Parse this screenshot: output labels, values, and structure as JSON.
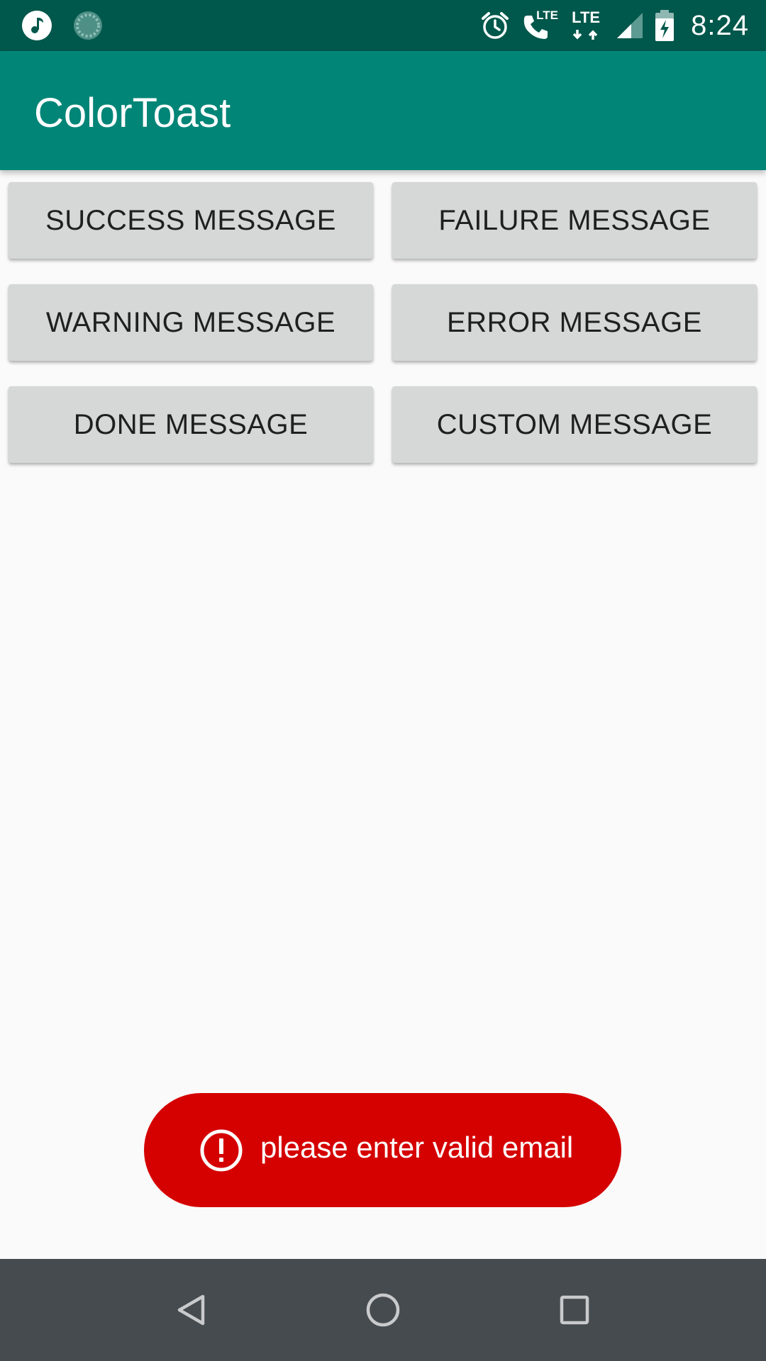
{
  "status_bar": {
    "time": "8:24",
    "left_icons": [
      "music-icon",
      "sync-icon"
    ],
    "right_icons": [
      "alarm-icon",
      "volte-call-icon",
      "lte-data-icon",
      "signal-icon",
      "battery-charging-icon"
    ],
    "volte_label": "LTE",
    "lte_label": "LTE"
  },
  "app_bar": {
    "title": "ColorToast"
  },
  "buttons": [
    {
      "label": "SUCCESS MESSAGE"
    },
    {
      "label": "FAILURE MESSAGE"
    },
    {
      "label": "WARNING MESSAGE"
    },
    {
      "label": "ERROR MESSAGE"
    },
    {
      "label": "DONE MESSAGE"
    },
    {
      "label": "CUSTOM MESSAGE"
    }
  ],
  "toast": {
    "icon": "error-exclamation-icon",
    "message": "please enter valid email",
    "color": "#d50000"
  },
  "nav_bar": {
    "icons": [
      "back-icon",
      "home-icon",
      "recents-icon"
    ]
  },
  "colors": {
    "status_bar": "#00574b",
    "app_bar": "#008577",
    "background": "#fafafa",
    "button": "#d6d7d7",
    "nav_bar": "#464b50"
  }
}
